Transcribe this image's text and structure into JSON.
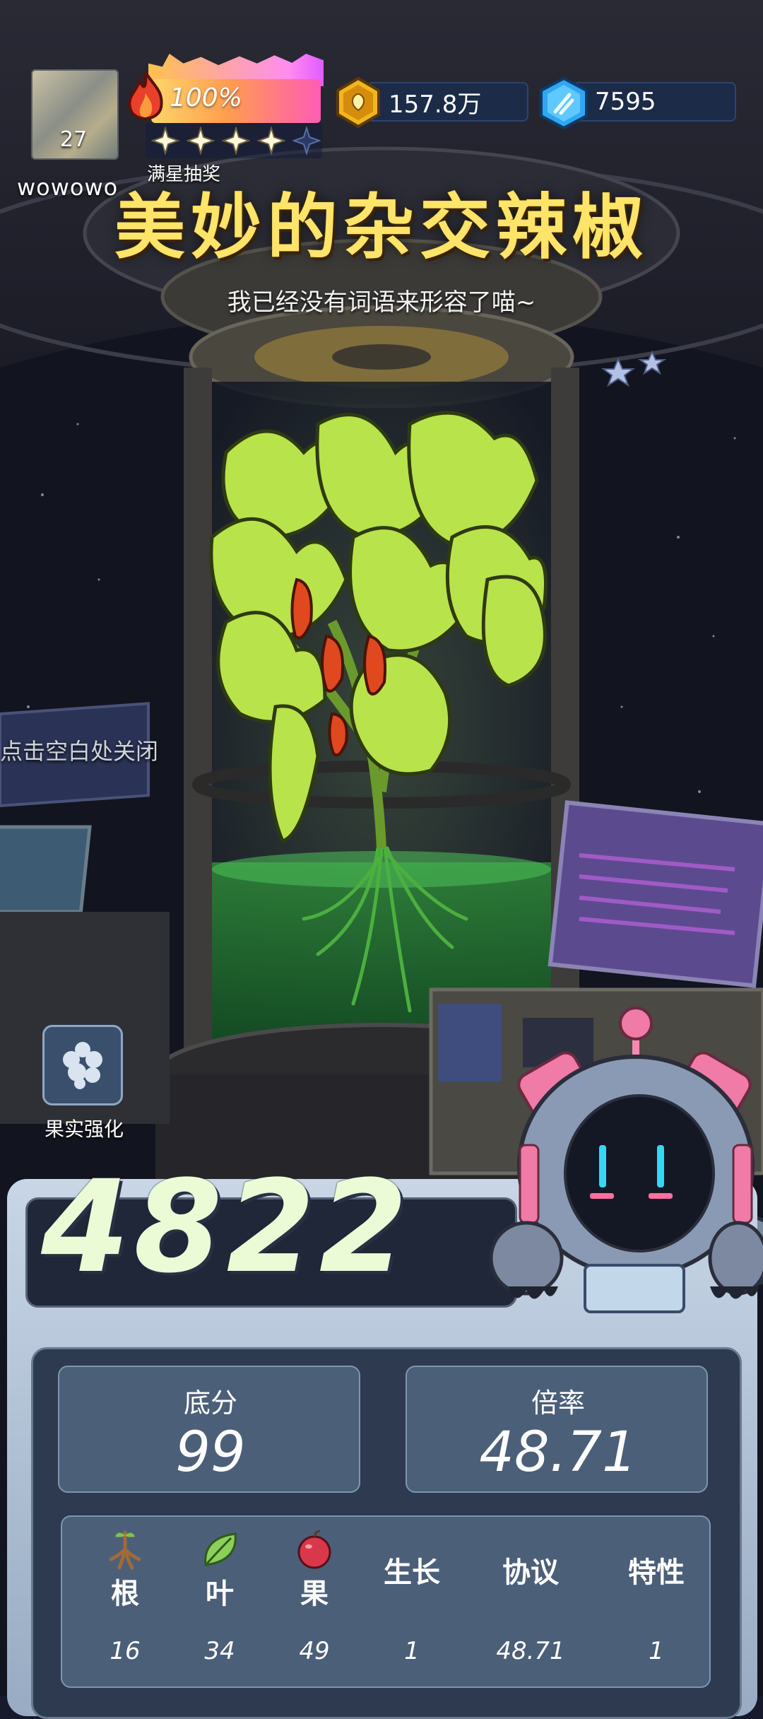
{
  "player": {
    "level": "27",
    "username": "wowowo"
  },
  "heat": {
    "percent_text": "100%",
    "value": 1.0
  },
  "stars": {
    "filled": 4,
    "total": 5,
    "caption": "满星抽奖"
  },
  "currency": {
    "gold": "157.8万",
    "gems": "7595"
  },
  "title": "美妙的杂交辣椒",
  "subtitle": "我已经没有词语来形容了喵~",
  "close_hint": "点击空白处关闭",
  "fruit_button": {
    "label": "果实强化",
    "icon": "berry-cluster-icon"
  },
  "score": {
    "total": "4822",
    "base_label": "底分",
    "base_value": "99",
    "multiplier_label": "倍率",
    "multiplier_value": "48.71"
  },
  "stats": [
    {
      "label": "根",
      "value": "16",
      "icon": "root-icon"
    },
    {
      "label": "叶",
      "value": "34",
      "icon": "leaf-icon"
    },
    {
      "label": "果",
      "value": "49",
      "icon": "apple-icon"
    },
    {
      "label": "生长",
      "value": "1"
    },
    {
      "label": "协议",
      "value": "48.71"
    },
    {
      "label": "特性",
      "value": "1"
    }
  ],
  "colors": {
    "title": "#ffe46a",
    "score": "#eafbd6",
    "panel": "#4c5f79",
    "accent_pink": "#ff5db4"
  }
}
